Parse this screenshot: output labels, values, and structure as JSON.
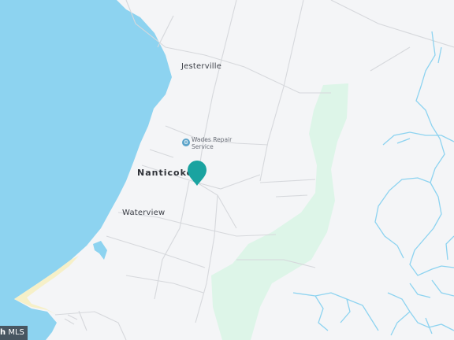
{
  "map": {
    "places": {
      "jesterville": "Jesterville",
      "nanticoke": "Nanticoke",
      "waterview": "Waterview"
    },
    "poi": {
      "name_line1": "Wades Repair",
      "name_line2": "Service"
    },
    "marker": {
      "color": "#1aa3a0"
    },
    "colors": {
      "water": "#8dd3f0",
      "land": "#f4f5f7",
      "park": "#ddf5e8",
      "road": "#d6d8dc",
      "beach": "#f6f0c8"
    },
    "attribution": {
      "brand": "h",
      "mls": "MLS"
    }
  }
}
